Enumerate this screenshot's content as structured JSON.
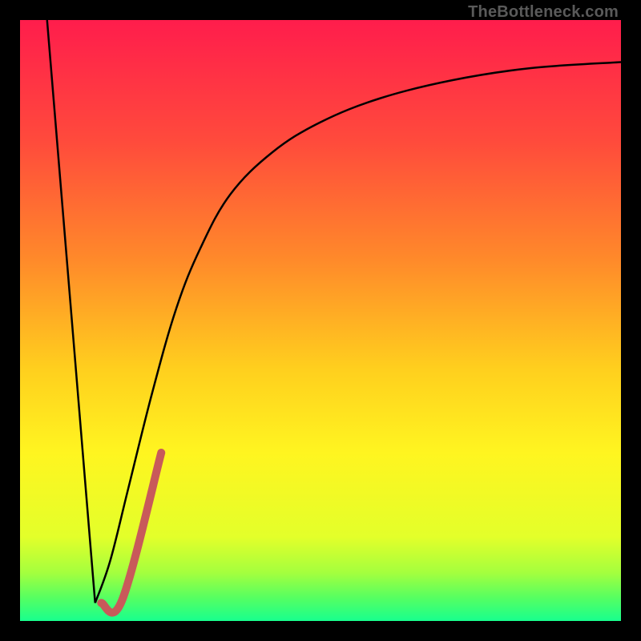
{
  "watermark": "TheBottleneck.com",
  "chart_data": {
    "type": "line",
    "title": "",
    "xlabel": "",
    "ylabel": "",
    "xlim": [
      0,
      100
    ],
    "ylim": [
      0,
      100
    ],
    "gradient_stops": [
      {
        "offset": 0,
        "color": "#ff1d4c"
      },
      {
        "offset": 20,
        "color": "#ff4a3c"
      },
      {
        "offset": 40,
        "color": "#ff8a2a"
      },
      {
        "offset": 58,
        "color": "#ffcf1e"
      },
      {
        "offset": 72,
        "color": "#fff520"
      },
      {
        "offset": 86,
        "color": "#e3ff2a"
      },
      {
        "offset": 92,
        "color": "#a4ff3e"
      },
      {
        "offset": 96,
        "color": "#58ff60"
      },
      {
        "offset": 100,
        "color": "#18ff8e"
      }
    ],
    "series": [
      {
        "name": "left-descent",
        "stroke": "#000000",
        "width": 2.5,
        "points": [
          {
            "x": 4.5,
            "y": 100
          },
          {
            "x": 12.5,
            "y": 3
          }
        ]
      },
      {
        "name": "right-ascent-curve",
        "stroke": "#000000",
        "width": 2.5,
        "points": [
          {
            "x": 12.5,
            "y": 3
          },
          {
            "x": 15,
            "y": 10
          },
          {
            "x": 18,
            "y": 22
          },
          {
            "x": 22,
            "y": 38
          },
          {
            "x": 26,
            "y": 52
          },
          {
            "x": 30,
            "y": 62
          },
          {
            "x": 35,
            "y": 71
          },
          {
            "x": 42,
            "y": 78
          },
          {
            "x": 50,
            "y": 83
          },
          {
            "x": 60,
            "y": 87
          },
          {
            "x": 72,
            "y": 90
          },
          {
            "x": 85,
            "y": 92
          },
          {
            "x": 100,
            "y": 93
          }
        ]
      },
      {
        "name": "highlight-segment",
        "stroke": "#c85a5a",
        "width": 10,
        "linecap": "round",
        "points": [
          {
            "x": 13.5,
            "y": 3
          },
          {
            "x": 17,
            "y": 3.5
          },
          {
            "x": 23.5,
            "y": 28
          }
        ]
      }
    ]
  }
}
